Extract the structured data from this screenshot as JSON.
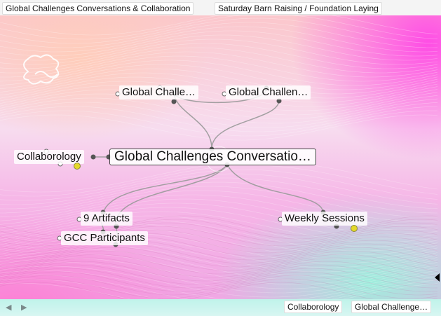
{
  "tabs": {
    "primary": "Global Challenges Conversations & Collaboration",
    "secondary": "Saturday Barn Raising / Foundation Laying"
  },
  "map": {
    "central": "Global Challenges Conversatio…",
    "top_left": "Global Challe…",
    "top_right": "Global Challen…",
    "left": "Collaborology",
    "artifacts": "9 Artifacts",
    "participants": "GCC Participants",
    "weekly": "Weekly Sessions"
  },
  "footer": {
    "back_icon": "◀",
    "forward_icon": "▶",
    "crumb_1": "Collaborology",
    "crumb_2": "Global Challenge…"
  },
  "colors": {
    "link_line": "#9a9a9a",
    "badge": "#e4d82a",
    "tab_bg": "#ffffff"
  }
}
